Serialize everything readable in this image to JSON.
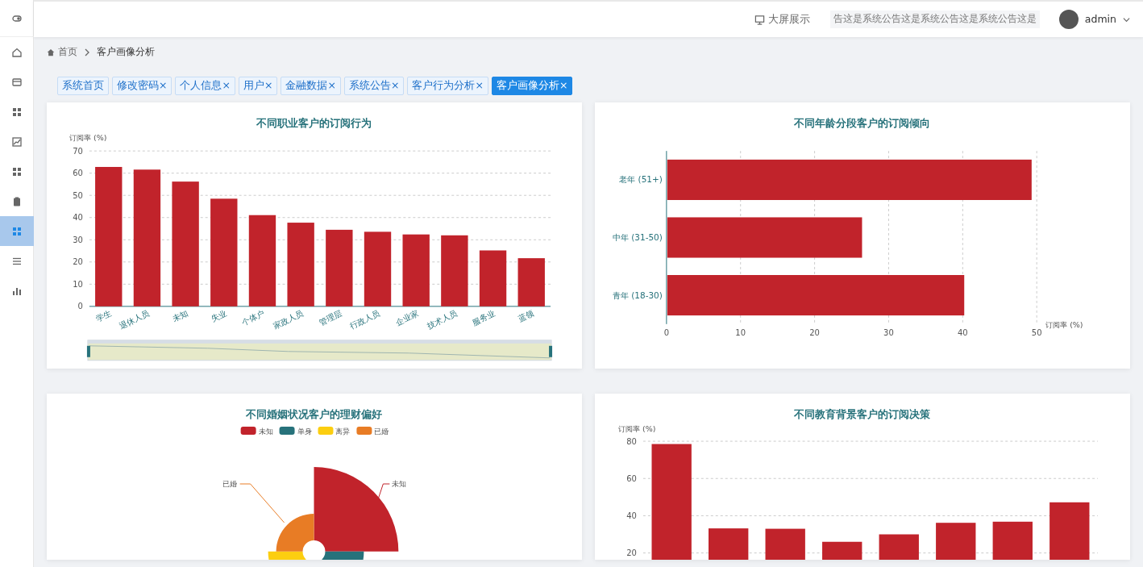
{
  "header": {
    "screen_button": "大屏展示",
    "notice": "告这是系统公告这是系统公告这是系统公告这是",
    "user": "admin"
  },
  "sidebar": {
    "items": [
      {
        "selected": false
      },
      {
        "selected": false
      },
      {
        "selected": false
      },
      {
        "selected": false
      },
      {
        "selected": false
      },
      {
        "selected": false
      },
      {
        "selected": true
      },
      {
        "selected": false
      },
      {
        "selected": false
      }
    ]
  },
  "breadcrumb": [
    "首页",
    "客户画像分析"
  ],
  "tabs": [
    {
      "label": "系统首页",
      "closable": false,
      "selected": false
    },
    {
      "label": "修改密码",
      "closable": true,
      "selected": false
    },
    {
      "label": "个人信息",
      "closable": true,
      "selected": false
    },
    {
      "label": "用户",
      "closable": true,
      "selected": false
    },
    {
      "label": "金融数据",
      "closable": true,
      "selected": false
    },
    {
      "label": "系统公告",
      "closable": true,
      "selected": false
    },
    {
      "label": "客户行为分析",
      "closable": true,
      "selected": false
    },
    {
      "label": "客户画像分析",
      "closable": true,
      "selected": true
    }
  ],
  "close_mark": "×",
  "panels": [
    {
      "chart_data": {
        "type": "bar",
        "title": "不同职业客户的订阅行为",
        "ylabel": "订阅率 (%)",
        "categories": [
          "学生",
          "退休人员",
          "未知",
          "失业",
          "个体户",
          "家政人员",
          "管理层",
          "行政人员",
          "企业家",
          "技术人员",
          "服务业",
          "蓝领"
        ],
        "values": [
          62.8,
          61.6,
          56.2,
          48.5,
          41.1,
          37.7,
          34.5,
          33.6,
          32.4,
          32.0,
          25.2,
          21.7
        ],
        "grid": true,
        "ylim": [
          0,
          70
        ],
        "yticks": [
          0,
          10,
          20,
          30,
          40,
          50,
          60,
          70
        ]
      }
    },
    {
      "chart_data": {
        "type": "bar",
        "orientation": "horizontal",
        "title": "不同年龄分段客户的订阅倾向",
        "xlabel": "订阅率 (%)",
        "categories": [
          "老年 (51+)",
          "中年 (31-50)",
          "青年 (18-30)"
        ],
        "values": [
          49.2,
          26.3,
          40.1
        ],
        "grid": true,
        "xlim": [
          0,
          50
        ],
        "xticks": [
          0,
          10,
          20,
          30,
          40,
          50
        ]
      }
    },
    {
      "title": "不同婚姻状况客户的理财偏好",
      "legend": [
        {
          "label": "未知",
          "color": "#c1232b"
        },
        {
          "label": "单身",
          "color": "#27727b"
        },
        {
          "label": "离异",
          "color": "#fcce10"
        },
        {
          "label": "已婚",
          "color": "#e87c25"
        }
      ],
      "slice_labels": [
        "已婚",
        "未知"
      ]
    },
    {
      "chart_data": {
        "type": "bar",
        "title": "不同教育背景客户的订阅决策",
        "ylabel": "订阅率 (%)",
        "values": [
          78.5,
          33.2,
          33.0,
          26.0,
          30.0,
          36.2,
          36.8,
          47.2
        ],
        "grid": true,
        "ylim": [
          0,
          80
        ],
        "yticks": [
          20,
          40,
          60,
          80
        ]
      }
    }
  ]
}
